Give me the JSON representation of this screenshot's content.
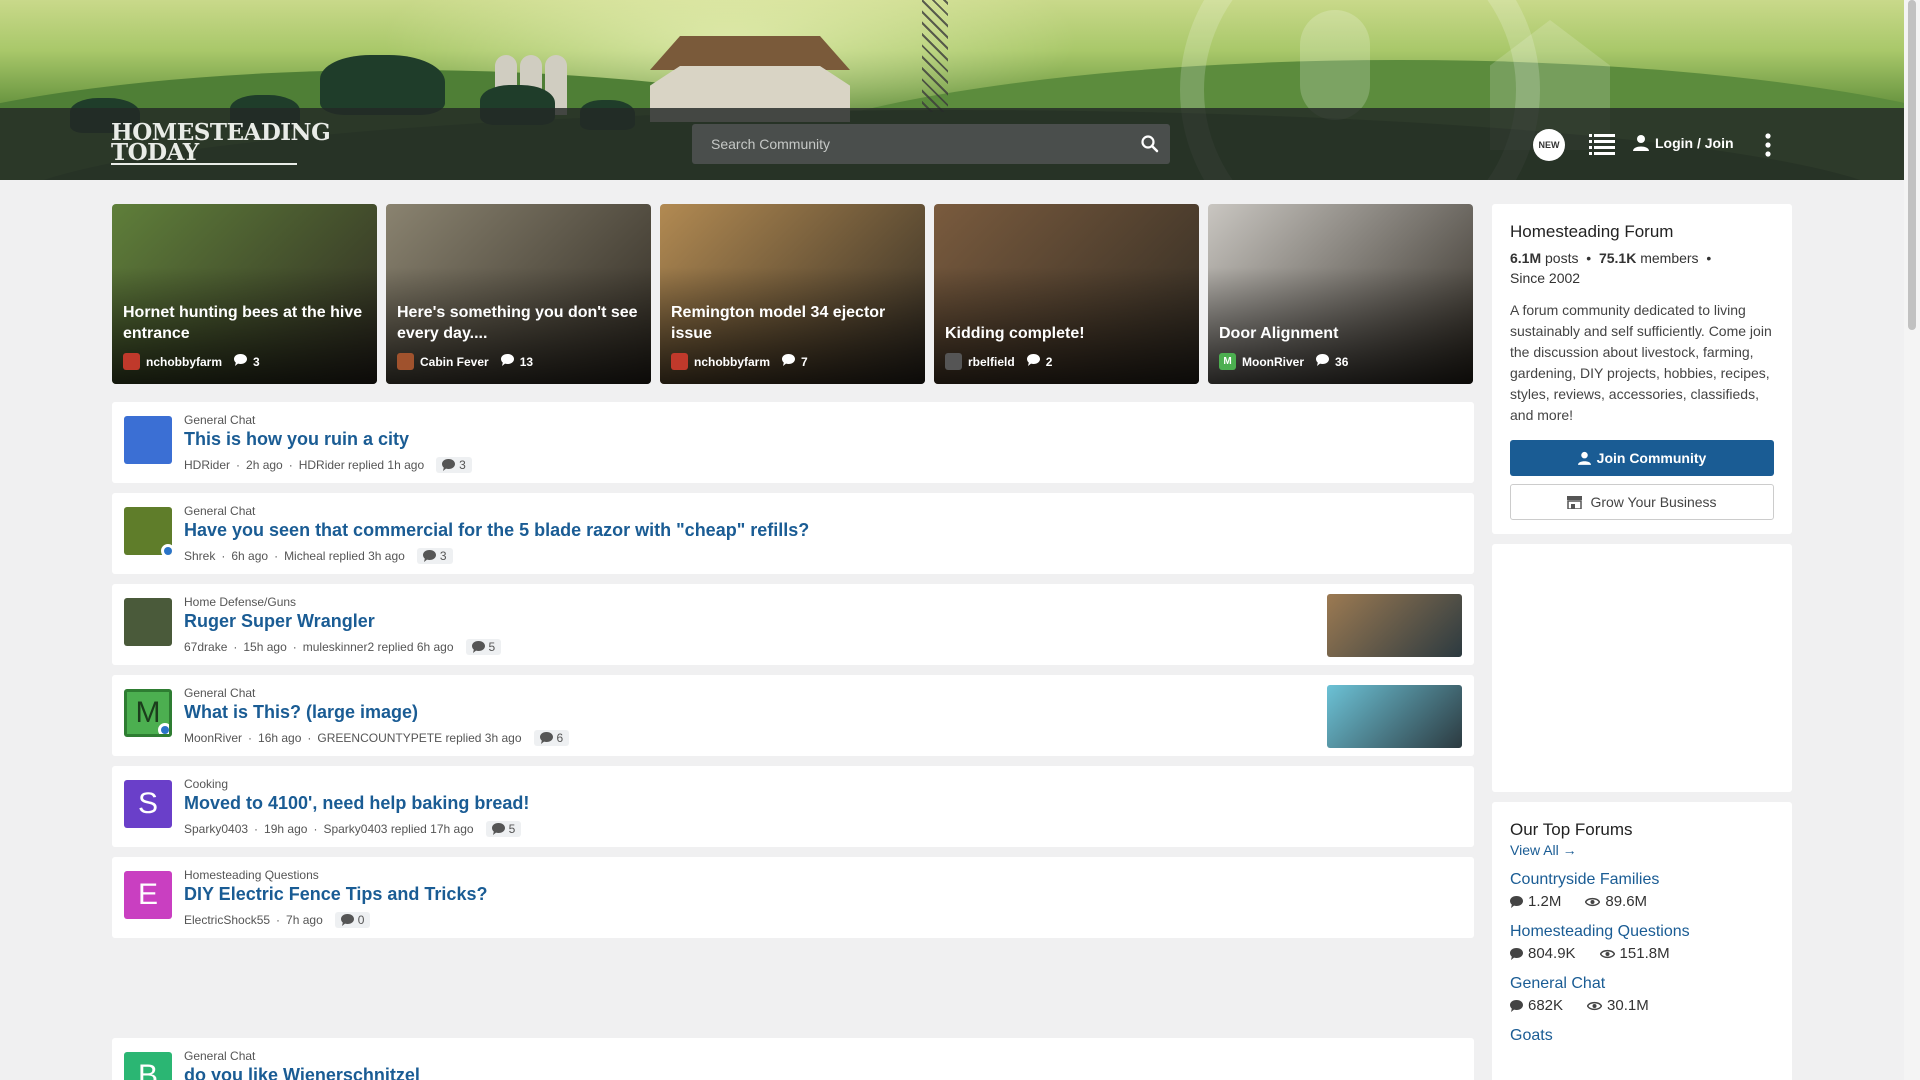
{
  "header": {
    "logo_line1": "HOMESTEADING",
    "logo_line2": "TODAY",
    "search_placeholder": "Search Community",
    "new_badge": "NEW",
    "login_label": "Login / Join"
  },
  "featured": [
    {
      "title": "Hornet hunting bees at the hive entrance",
      "author": "nchobbyfarm",
      "comments": "3",
      "bg": "#5f7f3a",
      "avatar_color": "#c0392b"
    },
    {
      "title": "Here's something you don't see every day....",
      "author": "Cabin Fever",
      "comments": "13",
      "bg": "#8a8370",
      "avatar_color": "#a0522d"
    },
    {
      "title": "Remington model 34 ejector issue",
      "author": "nchobbyfarm",
      "comments": "7",
      "bg": "#b28a52",
      "avatar_color": "#c0392b"
    },
    {
      "title": "Kidding complete!",
      "author": "rbelfield",
      "comments": "2",
      "bg": "#7a5b3e",
      "avatar_color": "#555555"
    },
    {
      "title": "Door Alignment",
      "author": "MoonRiver",
      "comments": "36",
      "bg": "#c9c6c1",
      "avatar_color": "#4caf50",
      "avatar_letter": "M"
    }
  ],
  "threads": [
    {
      "category": "General Chat",
      "title": "This is how you ruin a city",
      "author": "HDRider",
      "time": "2h ago",
      "replier": "HDRider replied 1h ago",
      "comments": "3",
      "avatar_color": "#3b6fd4",
      "avatar_letter": "",
      "mod": false,
      "thumb": ""
    },
    {
      "category": "General Chat",
      "title": "Have you seen that commercial for the 5 blade razor with \"cheap\" refills?",
      "author": "Shrek",
      "time": "6h ago",
      "replier": "Micheal replied 3h ago",
      "comments": "3",
      "avatar_color": "#5f7d2a",
      "avatar_letter": "",
      "mod": true,
      "thumb": ""
    },
    {
      "category": "Home Defense/Guns",
      "title": "Ruger Super Wrangler",
      "author": "67drake",
      "time": "15h ago",
      "replier": "muleskinner2 replied 6h ago",
      "comments": "5",
      "avatar_color": "#4a5a3a",
      "avatar_letter": "",
      "mod": false,
      "thumb": "#9c7a52"
    },
    {
      "category": "General Chat",
      "title": "What is This? (large image)",
      "author": "MoonRiver",
      "time": "16h ago",
      "replier": "GREENCOUNTYPETE replied 3h ago",
      "comments": "6",
      "avatar_color": "#4caf50",
      "avatar_letter": "M",
      "mod": true,
      "thumb": "#6cc2d6"
    },
    {
      "category": "Cooking",
      "title": "Moved to 4100', need help baking bread!",
      "author": "Sparky0403",
      "time": "19h ago",
      "replier": "Sparky0403 replied 17h ago",
      "comments": "5",
      "avatar_color": "#6a3fc9",
      "avatar_letter": "S",
      "mod": false,
      "thumb": ""
    },
    {
      "category": "Homesteading Questions",
      "title": "DIY Electric Fence Tips and Tricks?",
      "author": "ElectricShock55",
      "time": "7h ago",
      "replier": "",
      "comments": "0",
      "avatar_color": "#c93fc1",
      "avatar_letter": "E",
      "mod": false,
      "thumb": ""
    }
  ],
  "thread_last": {
    "category": "General Chat",
    "title": "do you like Wienerschnitzel",
    "avatar_letter": "B",
    "avatar_color": "#2bb673"
  },
  "about": {
    "title": "Homesteading Forum",
    "posts": "6.1M",
    "posts_label": "posts",
    "members": "75.1K",
    "members_label": "members",
    "since": "Since 2002",
    "description": "A forum community dedicated to living sustainably and self sufficiently. Come join the discussion about livestock, farming, gardening, DIY projects, hobbies, recipes, styles, reviews, accessories, classifieds, and more!",
    "join_label": "Join Community",
    "grow_label": "Grow Your Business"
  },
  "top_forums": {
    "title": "Our Top Forums",
    "view_all": "View All",
    "items": [
      {
        "name": "Countryside Families",
        "posts": "1.2M",
        "views": "89.6M"
      },
      {
        "name": "Homesteading Questions",
        "posts": "804.9K",
        "views": "151.8M"
      },
      {
        "name": "General Chat",
        "posts": "682K",
        "views": "30.1M"
      },
      {
        "name": "Goats",
        "posts": "",
        "views": ""
      }
    ]
  },
  "colors": {
    "accent": "#1a5c94",
    "header_bar": "#2a2e2c"
  }
}
